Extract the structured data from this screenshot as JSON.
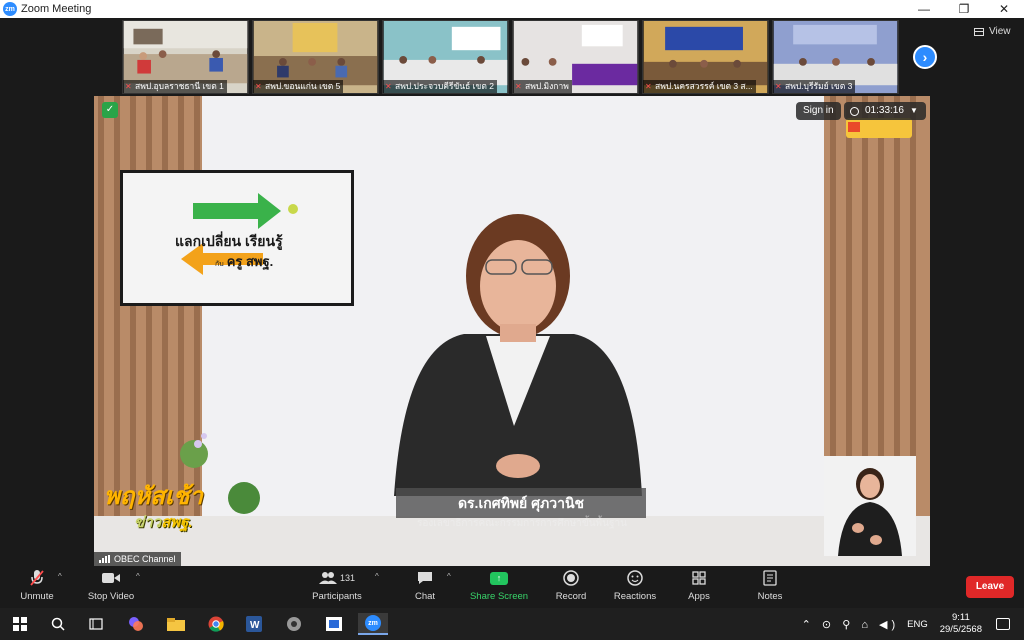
{
  "window": {
    "app_icon": "zm",
    "title": "Zoom Meeting",
    "minimize": "—",
    "maximize": "❐",
    "close": "✕"
  },
  "gallery": {
    "view_label": "View",
    "next_icon": "chevron-right-icon",
    "thumbnails": [
      {
        "label": "สพป.อุบลราชธานี เขต 1"
      },
      {
        "label": "สพป.ขอนแก่น เขต 5"
      },
      {
        "label": "สพป.ประจวบคีรีขันธ์ เขต 2"
      },
      {
        "label": "สพป.มิงกาพ"
      },
      {
        "label": "สพป.นครสวรรค์ เขต 3 ส..."
      },
      {
        "label": "สพป.บุรีรัมย์ เขต 3"
      }
    ]
  },
  "stage": {
    "sign_in": "Sign in",
    "timer": "01:33:16",
    "tv_line1": "แลกเปลี่ยน เรียนรู้",
    "tv_small": "กับ",
    "tv_line2": "ครู สพฐ.",
    "speaker_name": "ดร.เกศทิพย์ ศุภวานิช",
    "speaker_role": "รองเลขาธิการคณะกรรมการการศึกษาขั้นพื้นฐาน",
    "show_title": "พฤหัสเช้า",
    "show_sub_a": "ข่าว",
    "show_sub_b": "สพฐ.",
    "channel": "OBEC Channel"
  },
  "toolbar": {
    "unmute": "Unmute",
    "stop_video": "Stop Video",
    "participants": "Participants",
    "participants_count": "131",
    "chat": "Chat",
    "share_screen": "Share Screen",
    "record": "Record",
    "reactions": "Reactions",
    "apps": "Apps",
    "notes": "Notes",
    "leave": "Leave"
  },
  "taskbar": {
    "language": "ENG",
    "time": "9:11",
    "date": "29/5/2568"
  },
  "colors": {
    "zoom_blue": "#2d8cff",
    "leave_red": "#e02828",
    "share_green": "#22c55e"
  }
}
